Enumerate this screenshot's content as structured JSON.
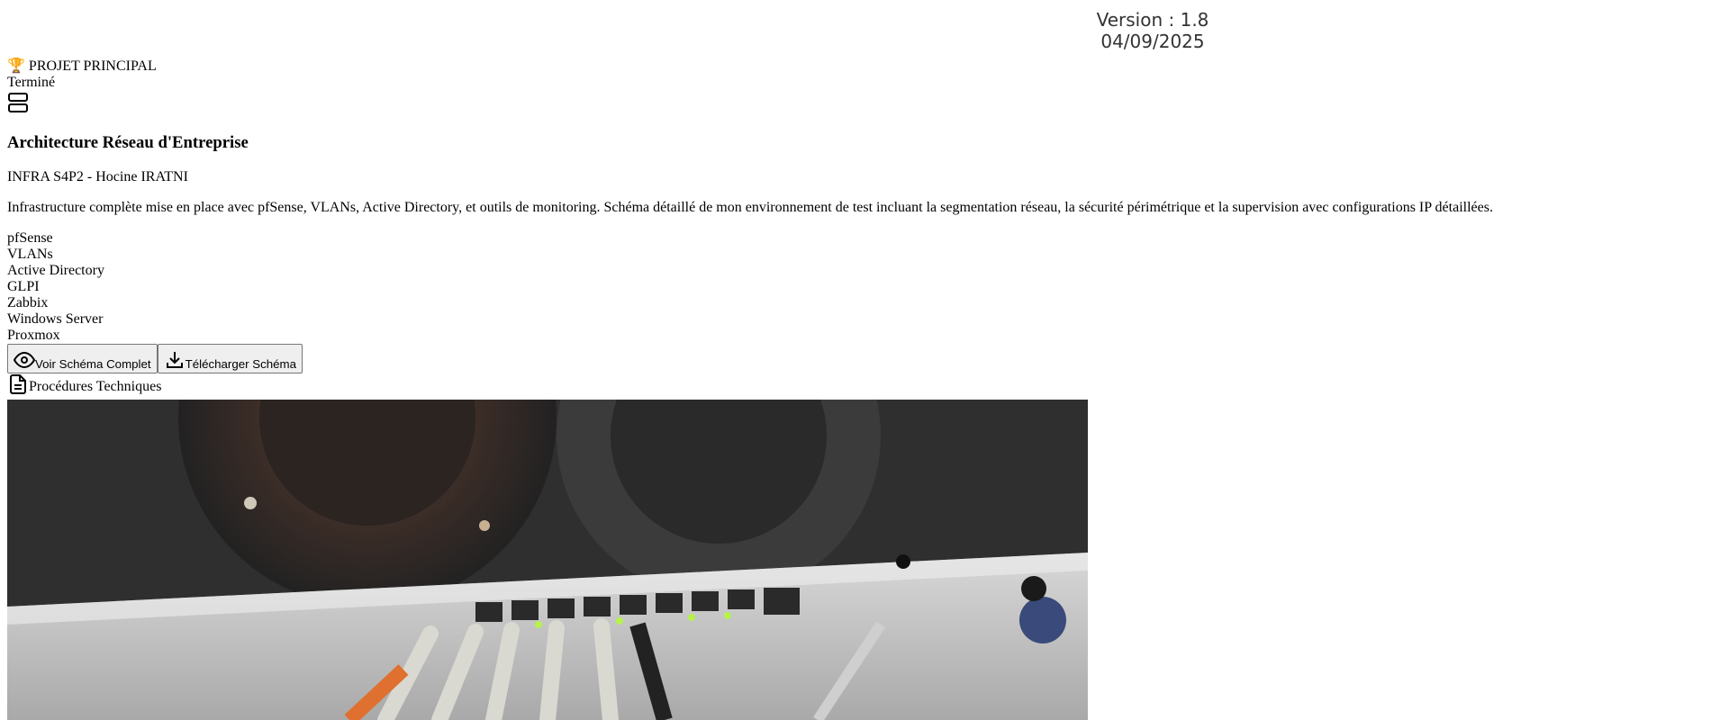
{
  "header": {
    "version": "Version : 1.8",
    "date": "04/09/2025"
  },
  "project": {
    "badge_icon": "trophy-icon",
    "badge": "🏆 PROJET PRINCIPAL",
    "status": "Terminé",
    "type_icon": "server-icon",
    "title": "Architecture Réseau d'Entreprise",
    "subtitle": "INFRA S4P2 - Hocine IRATNI",
    "description": "Infrastructure complète mise en place avec pfSense, VLANs, Active Directory, et outils de monitoring. Schéma détaillé de mon environnement de test incluant la segmentation réseau, la sécurité périmétrique et la supervision avec configurations IP détaillées.",
    "technologies": [
      "pfSense",
      "VLANs",
      "Active Directory",
      "GLPI",
      "Zabbix",
      "Windows Server",
      "Proxmox"
    ],
    "actions": {
      "view_label": "Voir Schéma Complet",
      "view_icon": "eye-icon",
      "download_label": "Télécharger Schéma",
      "download_icon": "download-icon"
    },
    "procedures_label": "Procédures Techniques",
    "procedures_icon": "document-icon"
  }
}
